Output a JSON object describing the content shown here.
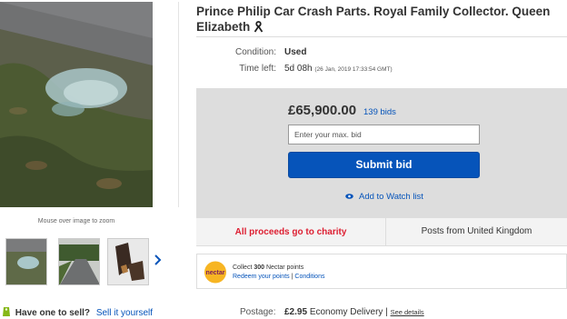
{
  "listing": {
    "title": "Prince Philip Car Crash Parts. Royal Family Collector. Queen Elizabeth",
    "condition_label": "Condition:",
    "condition_value": "Used",
    "time_left_label": "Time left:",
    "time_left_value": "5d 08h",
    "time_left_detail": "(26 Jan, 2019   17:33:54 GMT)"
  },
  "gallery": {
    "zoom_hint": "Mouse over image to zoom",
    "thumbnails": [
      "glass-on-grass",
      "roadside-verge",
      "broken-car-parts"
    ],
    "next_icon": "chevron-right-icon"
  },
  "sell": {
    "question": "Have one to sell?",
    "link": "Sell it yourself"
  },
  "bidding": {
    "price": "£65,900.00",
    "bid_count": "139 bids",
    "input_placeholder": "Enter your max. bid",
    "submit_label": "Submit bid",
    "watch_label": "Add to Watch list"
  },
  "info_bar": {
    "charity": "All proceeds go to charity",
    "posts_from": "Posts from United Kingdom"
  },
  "nectar": {
    "logo_text": "nectar",
    "collect_prefix": "Collect ",
    "collect_points": "300",
    "collect_suffix": " Nectar points",
    "redeem_link": "Redeem your points",
    "separator": "|",
    "conditions_link": "Conditions"
  },
  "postage": {
    "label": "Postage:",
    "price": "£2.95",
    "service": "Economy Delivery |",
    "details_link": "See details"
  },
  "colors": {
    "link_blue": "#0654ba",
    "charity_red": "#dd1e31",
    "bid_panel": "#dddddd"
  }
}
